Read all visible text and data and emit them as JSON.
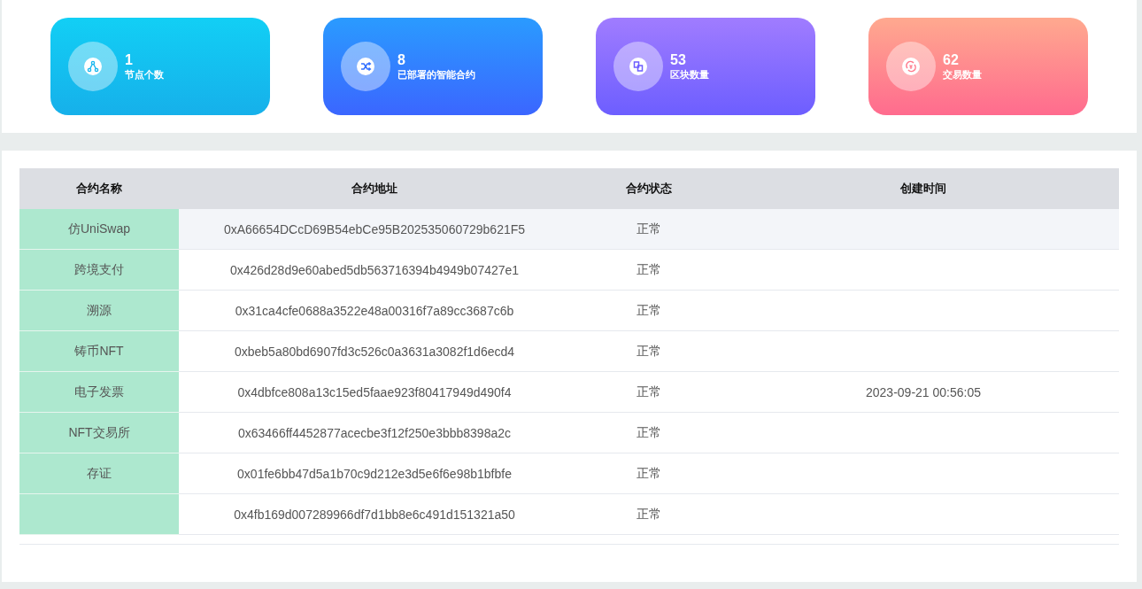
{
  "stats": [
    {
      "kind": "nodes",
      "value": "1",
      "label": "节点个数"
    },
    {
      "kind": "contracts",
      "value": "8",
      "label": "已部署的智能合约"
    },
    {
      "kind": "blocks",
      "value": "53",
      "label": "区块数量"
    },
    {
      "kind": "transactions",
      "value": "62",
      "label": "交易数量"
    }
  ],
  "table": {
    "columns": [
      "合约名称",
      "合约地址",
      "合约状态",
      "创建时间"
    ],
    "rows": [
      {
        "highlighted": true,
        "cells": [
          "仿UniSwap",
          "0xA66654DCcD69B54ebCe95B202535060729b621F5",
          "正常",
          ""
        ]
      },
      {
        "highlighted": false,
        "cells": [
          "跨境支付",
          "0x426d28d9e60abed5db563716394b4949b07427e1",
          "正常",
          ""
        ]
      },
      {
        "highlighted": false,
        "cells": [
          "溯源",
          "0x31ca4cfe0688a3522e48a00316f7a89cc3687c6b",
          "正常",
          ""
        ]
      },
      {
        "highlighted": false,
        "cells": [
          "铸币NFT",
          "0xbeb5a80bd6907fd3c526c0a3631a3082f1d6ecd4",
          "正常",
          ""
        ]
      },
      {
        "highlighted": false,
        "cells": [
          "电子发票",
          "0x4dbfce808a13c15ed5faae923f80417949d490f4",
          "正常",
          "2023-09-21 00:56:05"
        ]
      },
      {
        "highlighted": false,
        "cells": [
          "NFT交易所",
          "0x63466ff4452877acecbe3f12f250e3bbb8398a2c",
          "正常",
          ""
        ]
      },
      {
        "highlighted": false,
        "cells": [
          "存证",
          "0x01fe6bb47d5a1b70c9d212e3d5e6f6e98b1bfbfe",
          "正常",
          ""
        ]
      },
      {
        "highlighted": false,
        "cells": [
          "",
          "0x4fb169d007289966df7d1bb8e6c491d151321a50",
          "正常",
          ""
        ]
      }
    ]
  }
}
